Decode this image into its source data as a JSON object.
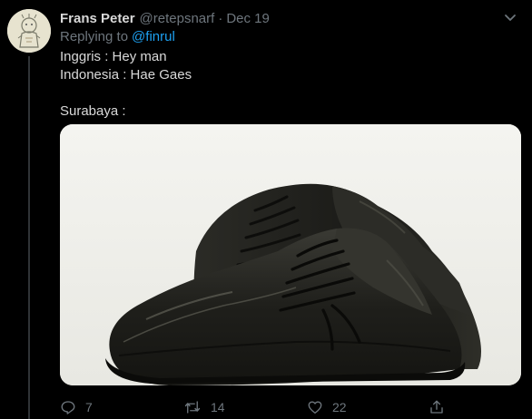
{
  "tweet": {
    "author_name": "Frans Peter",
    "handle": "@retepsnarf",
    "separator": "·",
    "date": "Dec 19",
    "replying_prefix": "Replying to",
    "replying_to": "@finrul",
    "text": "Inggris : Hey man\nIndonesia : Hae Gaes\n\nSurabaya :",
    "media_icon": "black-leather-shoes-photo"
  },
  "actions": {
    "reply_count": "7",
    "retweet_count": "14",
    "like_count": "22",
    "share_label": ""
  },
  "colors": {
    "background": "#000000",
    "text": "#d9d9d9",
    "secondary": "#6e767d",
    "link": "#1da1f2"
  }
}
